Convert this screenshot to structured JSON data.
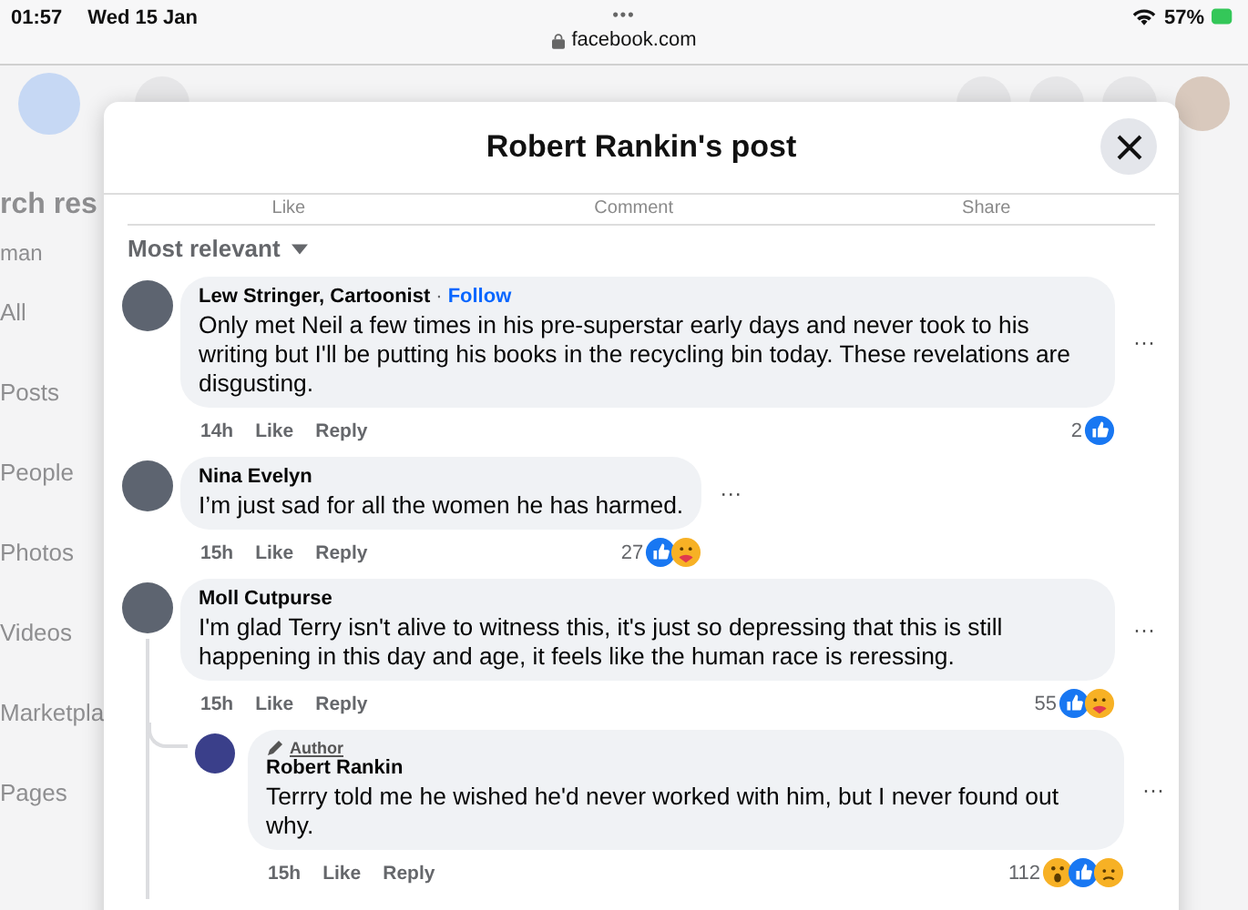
{
  "status_bar": {
    "time": "01:57",
    "date": "Wed 15 Jan",
    "menu": "•••",
    "url": "facebook.com",
    "battery": "57%"
  },
  "background": {
    "heading": "rch res",
    "subheading": "man",
    "sidebar_items": [
      "All",
      "Posts",
      "People",
      "Photos",
      "Videos",
      "Marketpla",
      "Pages"
    ]
  },
  "modal": {
    "title": "Robert Rankin's post",
    "actions": [
      "Like",
      "Comment",
      "Share"
    ],
    "sort": "Most relevant",
    "comments": [
      {
        "author": "Lew Stringer, Cartoonist",
        "separator": "·",
        "follow": "Follow",
        "text": "Only met Neil a few times in his pre-superstar early days and never took to his writing but I'll be putting his books in the recycling bin today. These revelations are disgusting.",
        "more": "···",
        "time": "14h",
        "like": "Like",
        "reply": "Reply",
        "reaction_count": "2",
        "reactions": [
          {
            "kind": "like"
          }
        ]
      },
      {
        "author": "Nina Evelyn",
        "text": "I’m just sad for all the women he has harmed.",
        "more": "···",
        "time": "15h",
        "like": "Like",
        "reply": "Reply",
        "reaction_count": "27",
        "reactions": [
          {
            "kind": "like"
          },
          {
            "kind": "care"
          }
        ]
      },
      {
        "author": "Moll Cutpurse",
        "text": "I'm glad Terry isn't alive to witness this, it's just so depressing that this is still happening in this day and age, it feels like the human race is reressing.",
        "more": "···",
        "time": "15h",
        "like": "Like",
        "reply": "Reply",
        "reaction_count": "55",
        "reactions": [
          {
            "kind": "like"
          },
          {
            "kind": "care"
          }
        ],
        "replies": [
          {
            "badge": "Author",
            "author": "Robert Rankin",
            "text": "Terrry told me he wished he'd never worked with him, but I never found out why.",
            "more": "···",
            "time": "15h",
            "like": "Like",
            "reply": "Reply",
            "reaction_count": "112",
            "reactions": [
              {
                "kind": "wow"
              },
              {
                "kind": "like"
              },
              {
                "kind": "sad"
              }
            ]
          }
        ]
      }
    ]
  }
}
